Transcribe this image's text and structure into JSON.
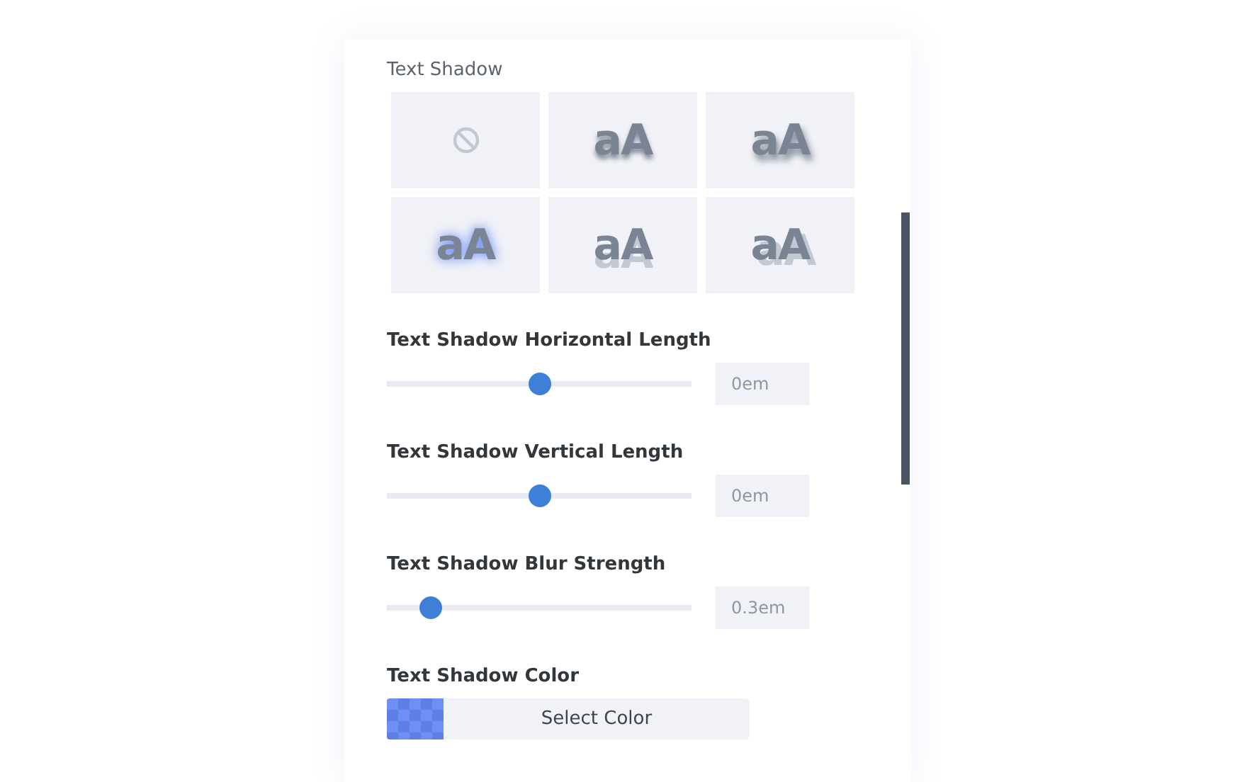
{
  "section_title": "Text Shadow",
  "presets": [
    {
      "kind": "none"
    },
    {
      "kind": "soft",
      "label": "aA"
    },
    {
      "kind": "far",
      "label": "aA"
    },
    {
      "kind": "glow",
      "label": "aA"
    },
    {
      "kind": "offset",
      "label": "aA"
    },
    {
      "kind": "extrude",
      "label": "aA"
    }
  ],
  "sliders": [
    {
      "label": "Text Shadow Horizontal Length",
      "level": 0.5,
      "value": "0em"
    },
    {
      "label": "Text Shadow Vertical Length",
      "level": 0.5,
      "value": "0em"
    },
    {
      "label": "Text Shadow Blur Strength",
      "level": 0.17,
      "value": "0.3em"
    }
  ],
  "color": {
    "label": "Text Shadow Color",
    "button": "Select Color"
  }
}
